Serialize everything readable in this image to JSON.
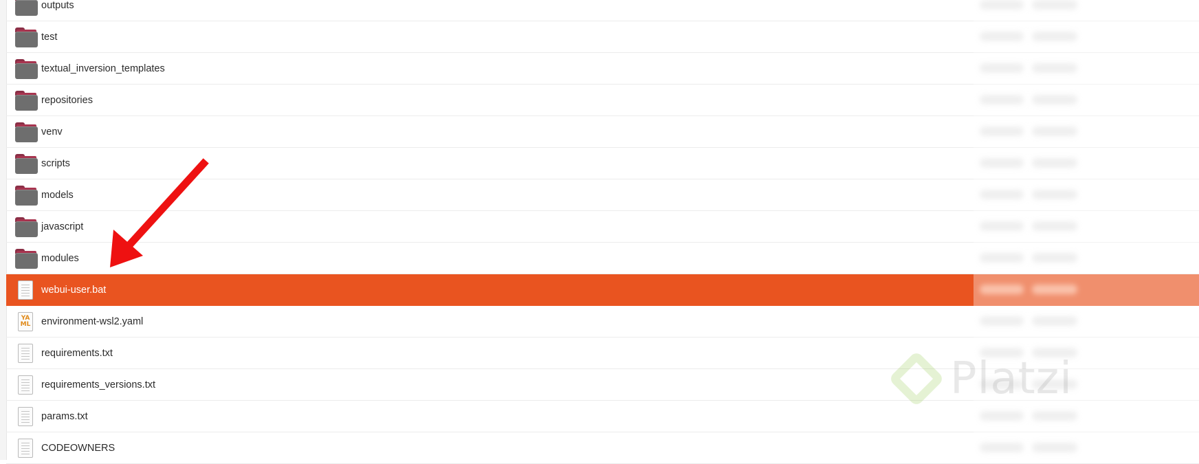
{
  "files": [
    {
      "name": "outputs",
      "type": "folder"
    },
    {
      "name": "test",
      "type": "folder"
    },
    {
      "name": "textual_inversion_templates",
      "type": "folder"
    },
    {
      "name": "repositories",
      "type": "folder"
    },
    {
      "name": "venv",
      "type": "folder"
    },
    {
      "name": "scripts",
      "type": "folder"
    },
    {
      "name": "models",
      "type": "folder"
    },
    {
      "name": "javascript",
      "type": "folder"
    },
    {
      "name": "modules",
      "type": "folder"
    },
    {
      "name": "webui-user.bat",
      "type": "text",
      "selected": true
    },
    {
      "name": "environment-wsl2.yaml",
      "type": "yaml"
    },
    {
      "name": "requirements.txt",
      "type": "text"
    },
    {
      "name": "requirements_versions.txt",
      "type": "text"
    },
    {
      "name": "params.txt",
      "type": "text"
    },
    {
      "name": "CODEOWNERS",
      "type": "text"
    }
  ],
  "yaml_icon_text": "YA ML",
  "watermark": {
    "text": "Platzi",
    "color": "#8dc63f"
  },
  "colors": {
    "selection": "#e95420",
    "annotation_arrow": "#ee1111"
  }
}
